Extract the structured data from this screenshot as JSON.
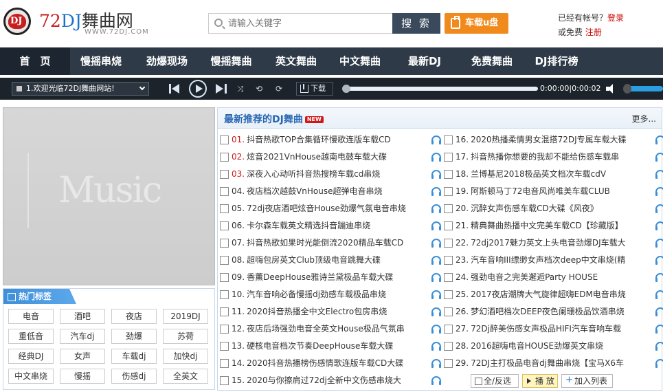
{
  "brand": {
    "logo_mark": "DJ",
    "name_num": "72",
    "name_dj": "DJ",
    "name_cn": "舞曲网",
    "url": "WWW.72DJ.COM"
  },
  "search": {
    "placeholder": "请输入关键字",
    "button": "搜 索"
  },
  "car_button": "车载u盘",
  "account": {
    "prompt": "已经有帐号？",
    "login": "登录",
    "free_prefix": "或免费",
    "register": "注册"
  },
  "nav": [
    "首　页",
    "慢摇串烧",
    "劲爆现场",
    "慢摇舞曲",
    "英文舞曲",
    "中文舞曲",
    "最新DJ",
    "免费舞曲",
    "DJ排行榜"
  ],
  "player": {
    "current_track": "1.欢迎光临72DJ舞曲网站!",
    "download": "下载",
    "time": "0:00:00|0:00:02",
    "volume": 0.95,
    "progress": 0.0
  },
  "banner_text": "Music",
  "tags": {
    "heading": "热门标签",
    "items": [
      "电音",
      "酒吧",
      "夜店",
      "2019DJ",
      "重低音",
      "汽车dj",
      "劲爆",
      "苏荷",
      "经典DJ",
      "女声",
      "车载dj",
      "加快dj",
      "中文串烧",
      "慢摇",
      "伤感dj",
      "全英文"
    ]
  },
  "list": {
    "title": "最新推荐的DJ舞曲",
    "new_badge": "NEW",
    "more": "更多...",
    "left": [
      {
        "num": "01.",
        "title": "抖音热歌TOP合集循环慢歌连版车载CD",
        "red": true
      },
      {
        "num": "02.",
        "title": "炫音2021VnHouse越南电鼓车载大碟",
        "red": true
      },
      {
        "num": "03.",
        "title": "深夜入心动听抖音热搜榜车载cd串烧",
        "red": true
      },
      {
        "num": "04.",
        "title": "夜店档次越鼓VnHouse超弹电音串烧",
        "red": false
      },
      {
        "num": "05.",
        "title": "72dj夜店酒吧炫音House劲爆气氛电音串烧",
        "red": false
      },
      {
        "num": "06.",
        "title": "卡尔森车载英文精选抖音蹦迪串烧",
        "red": false
      },
      {
        "num": "07.",
        "title": "抖音热歌如果时光能倒流2020精品车载CD",
        "red": false
      },
      {
        "num": "08.",
        "title": "超嗨包房英文Club顶级电音跳舞大碟",
        "red": false
      },
      {
        "num": "09.",
        "title": "香薰DeepHouse雅诗兰黛极品车载大碟",
        "red": false
      },
      {
        "num": "10.",
        "title": "汽车音响必备慢摇dj劲感车载极品串烧",
        "red": false
      },
      {
        "num": "11.",
        "title": "2020抖音热播全中文Electro包房串烧",
        "red": false
      },
      {
        "num": "12.",
        "title": "夜店后场强劲电音全英文House极品气氛串",
        "red": false
      },
      {
        "num": "13.",
        "title": "硬核电音档次节奏DeepHouse车载大碟",
        "red": false
      },
      {
        "num": "14.",
        "title": "2020抖音热播榜伤感情歌连版车载CD大碟",
        "red": false
      },
      {
        "num": "15.",
        "title": "2020与你擦肩过72dj全新中文伤感串烧大",
        "red": false
      }
    ],
    "right": [
      {
        "num": "16.",
        "title": "2020热播柔情男女混搭72DJ专属车载大碟"
      },
      {
        "num": "17.",
        "title": "抖音热播你想要的我却不能给伤感车载串"
      },
      {
        "num": "18.",
        "title": "兰博基尼2018极品英文档次车载cdV"
      },
      {
        "num": "19.",
        "title": "阿斯顿马丁72电音风尚唯美车载CLUB"
      },
      {
        "num": "20.",
        "title": "沉醉女声伤感车载CD大碟《风夜》"
      },
      {
        "num": "21.",
        "title": "精典舞曲热播中文完美车载CD【珍藏版】"
      },
      {
        "num": "22.",
        "title": "72dj2017魅力英文上头电音劲爆DJ车载大"
      },
      {
        "num": "23.",
        "title": "汽车音响III缥缈女声档次deep中文串烧(精"
      },
      {
        "num": "24.",
        "title": "强劲电音之完美邂逅Party HOUSE"
      },
      {
        "num": "25.",
        "title": "2017夜店潮牌大气旋律超嗨EDM电音串烧"
      },
      {
        "num": "26.",
        "title": "梦幻酒吧档次DEEP夜色阑珊极品饮酒串烧"
      },
      {
        "num": "27.",
        "title": "72Dj醉美伤感女声极品HIFI汽车音响车载"
      },
      {
        "num": "28.",
        "title": "2016超嗨电音HOUSE劲爆英文串烧"
      },
      {
        "num": "29.",
        "title": "72DJ主打极品电音dj舞曲串烧【宝马X6车"
      }
    ],
    "buttons": {
      "select": "全/反选",
      "play": "播 放",
      "add": "加入列表"
    }
  },
  "colors": {
    "nav_bg": "#2e3a48",
    "player_bg": "#1c232b",
    "accent_orange": "#f08a1c",
    "brand_red": "#c81e1e",
    "link_blue": "#2867b3"
  }
}
